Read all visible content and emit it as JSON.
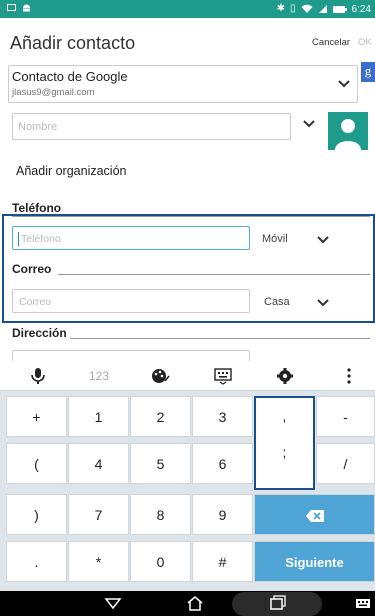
{
  "status_bar": {
    "time": "6:24",
    "left_icons": [
      "notification-icon",
      "android-icon"
    ],
    "right_icons": [
      "bluetooth-icon",
      "vibrate-icon",
      "wifi-icon",
      "no-sim-icon",
      "battery-icon"
    ]
  },
  "header": {
    "title": "Añadir contacto",
    "cancel_label": "Cancelar",
    "ok_label": "OK"
  },
  "account": {
    "name": "Contacto de Google",
    "email": "jlasus9@gmail.com",
    "badge": "g"
  },
  "name_field": {
    "placeholder": "Nombre"
  },
  "add_org_label": "Añadir organización",
  "phone": {
    "section_label": "Teléfono",
    "placeholder": "Teléfono",
    "type": "Móvil"
  },
  "email": {
    "section_label": "Correo",
    "placeholder": "Correo",
    "type": "Casa"
  },
  "address": {
    "section_label": "Dirección"
  },
  "keyboard": {
    "toolbar": [
      "mic-icon",
      "123",
      "palette-icon",
      "keyboard-icon",
      "settings-icon",
      "more-icon"
    ],
    "label_123": "123",
    "rows": [
      [
        "+",
        "1",
        "2",
        "3",
        ",",
        "-"
      ],
      [
        "(",
        "4",
        "5",
        "6",
        ";",
        "/"
      ],
      [
        ")",
        "7",
        "8",
        "9",
        "⌫",
        ""
      ],
      [
        ".",
        "*",
        "0",
        "#",
        "Siguiente",
        ""
      ]
    ]
  },
  "colors": {
    "accent": "#1e9b8a",
    "focus": "#1b4e8f",
    "key_blue": "#4fa4d6"
  }
}
